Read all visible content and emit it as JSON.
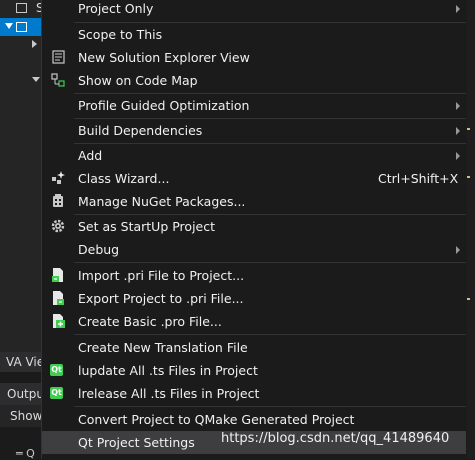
{
  "background": {
    "tree_row_label": "S",
    "va_view_tab": "VA Vie",
    "output_bar": "Outpu",
    "show_bar": "Show",
    "bottom_line": "═ Q"
  },
  "menu": {
    "items": [
      {
        "label": "Project Only",
        "submenu": true
      },
      {
        "label": "Scope to This"
      },
      {
        "label": "New Solution Explorer View",
        "icon": "new-view-icon"
      },
      {
        "label": "Show on Code Map",
        "icon": "code-map-icon"
      },
      {
        "label": "Profile Guided Optimization",
        "submenu": true
      },
      {
        "label": "Build Dependencies",
        "submenu": true
      },
      {
        "label": "Add",
        "submenu": true
      },
      {
        "label": "Class Wizard...",
        "shortcut": "Ctrl+Shift+X",
        "icon": "class-wizard-icon"
      },
      {
        "label": "Manage NuGet Packages...",
        "icon": "nuget-icon"
      },
      {
        "label": "Set as StartUp Project",
        "icon": "gear-icon"
      },
      {
        "label": "Debug",
        "submenu": true
      },
      {
        "label": "Import .pri File to Project...",
        "icon": "import-pri-icon"
      },
      {
        "label": "Export Project to .pri File...",
        "icon": "export-pri-icon"
      },
      {
        "label": "Create Basic .pro File...",
        "icon": "create-pro-icon"
      },
      {
        "label": "Create New Translation File"
      },
      {
        "label": "lupdate All .ts Files in Project",
        "icon": "qt-icon"
      },
      {
        "label": "lrelease All .ts Files in Project",
        "icon": "qt-icon"
      },
      {
        "label": "Convert Project to QMake Generated Project"
      },
      {
        "label": "Qt Project Settings"
      }
    ]
  },
  "watermark": "https://blog.csdn.net/qq_41489640",
  "colors": {
    "menu_background": "#1b1b1c",
    "hover": "#3e3e40",
    "selection": "#007acc",
    "qt_green": "#41cd52"
  }
}
